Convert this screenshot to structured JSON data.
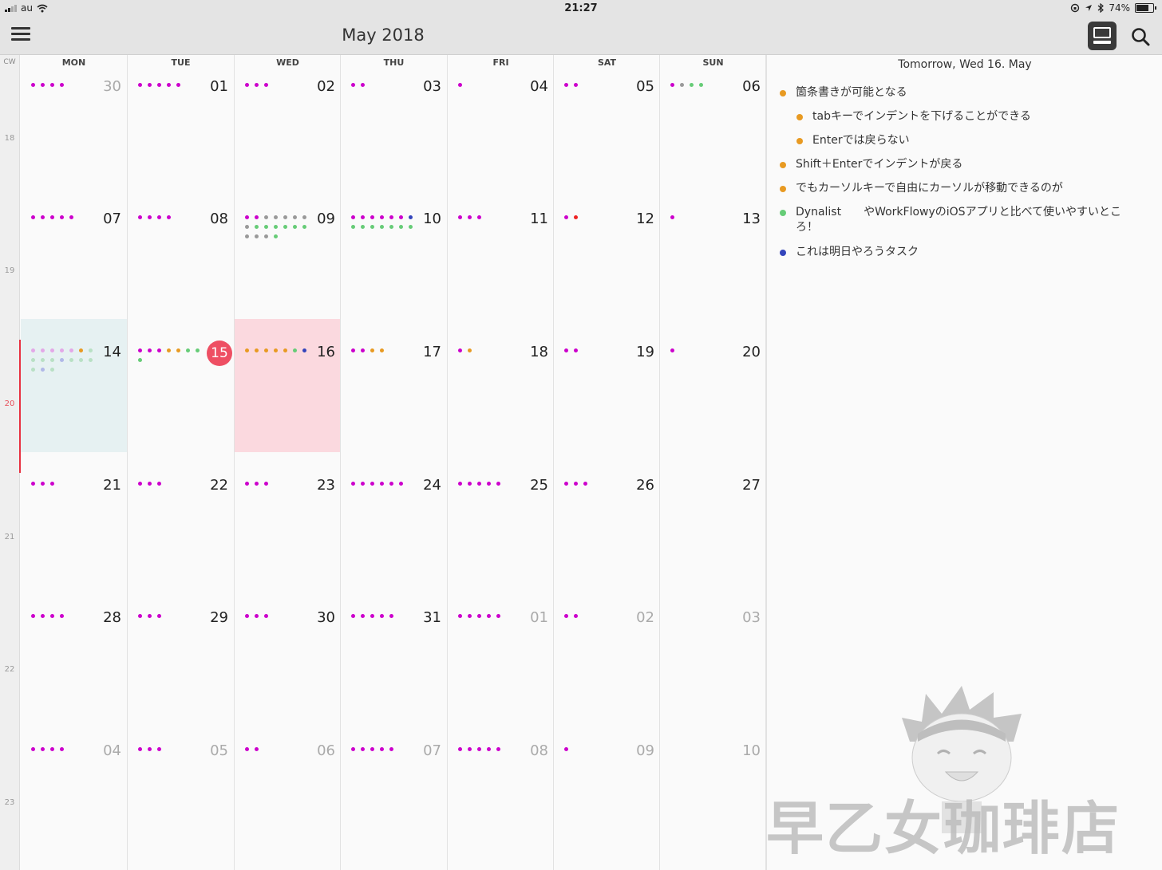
{
  "status_bar": {
    "carrier": "au",
    "time": "21:27",
    "battery": "74%",
    "battery_level": 0.74
  },
  "header": {
    "title": "May 2018",
    "menu_icon": "hamburger-icon",
    "view_icon": "tablet-layout-icon",
    "search_icon": "search-icon"
  },
  "calendar": {
    "cw_label": "CW",
    "weekdays": [
      "MON",
      "TUE",
      "WED",
      "THU",
      "FRI",
      "SAT",
      "SUN"
    ],
    "calendar_weeks": [
      "18",
      "19",
      "20",
      "21",
      "22",
      "23"
    ],
    "current_week": "20",
    "weeks": [
      [
        {
          "day": "30",
          "other": true,
          "dots": [
            "#cc00cc",
            "#cc00cc",
            "#cc00cc",
            "#cc00cc"
          ]
        },
        {
          "day": "01",
          "dots": [
            "#cc00cc",
            "#cc00cc",
            "#cc00cc",
            "#cc00cc",
            "#cc00cc"
          ]
        },
        {
          "day": "02",
          "dots": [
            "#cc00cc",
            "#cc00cc",
            "#cc00cc"
          ]
        },
        {
          "day": "03",
          "dots": [
            "#cc00cc",
            "#cc00cc"
          ]
        },
        {
          "day": "04",
          "dots": [
            "#cc00cc"
          ]
        },
        {
          "day": "05",
          "dots": [
            "#cc00cc",
            "#cc00cc"
          ]
        },
        {
          "day": "06",
          "dots": [
            "#cc00cc",
            "#999999",
            "#66cc77",
            "#66cc77"
          ]
        }
      ],
      [
        {
          "day": "07",
          "dots": [
            "#cc00cc",
            "#cc00cc",
            "#cc00cc",
            "#cc00cc",
            "#cc00cc"
          ]
        },
        {
          "day": "08",
          "dots": [
            "#cc00cc",
            "#cc00cc",
            "#cc00cc",
            "#cc00cc"
          ]
        },
        {
          "day": "09",
          "dots": [
            "#cc00cc",
            "#cc00cc",
            "#999999",
            "#999999",
            "#999999",
            "#999999",
            "#999999",
            "#999999",
            "#66cc77",
            "#66cc77",
            "#66cc77",
            "#66cc77",
            "#66cc77",
            "#66cc77",
            "#999999",
            "#999999",
            "#999999",
            "#66cc77"
          ]
        },
        {
          "day": "10",
          "dots": [
            "#cc00cc",
            "#cc00cc",
            "#cc00cc",
            "#cc00cc",
            "#cc00cc",
            "#cc00cc",
            "#3344bb",
            "#66cc77",
            "#66cc77",
            "#66cc77",
            "#66cc77",
            "#66cc77",
            "#66cc77",
            "#66cc77"
          ]
        },
        {
          "day": "11",
          "dots": [
            "#cc00cc",
            "#cc00cc",
            "#cc00cc"
          ]
        },
        {
          "day": "12",
          "dots": [
            "#cc00cc",
            "#ee2222"
          ]
        },
        {
          "day": "13",
          "dots": [
            "#cc00cc"
          ]
        }
      ],
      [
        {
          "day": "14",
          "today": true,
          "dots": [
            "#e3a8e8",
            "#e3a8e8",
            "#e3a8e8",
            "#e3a8e8",
            "#e3a8e8",
            "#e89a22",
            "#b8e0c4",
            "#b8e0c4",
            "#b8e0c4",
            "#b8e0c4",
            "#b0b8e8",
            "#b8e0c4",
            "#b8e0c4",
            "#b8e0c4",
            "#b8e0c4",
            "#b0b8e8",
            "#b8e0c4"
          ]
        },
        {
          "day": "15",
          "badge": true,
          "dots": [
            "#cc00cc",
            "#cc00cc",
            "#cc00cc",
            "#e89a22",
            "#e89a22",
            "#66cc77",
            "#66cc77",
            "#66cc77"
          ]
        },
        {
          "day": "16",
          "selected": true,
          "dots": [
            "#e89a22",
            "#e89a22",
            "#e89a22",
            "#e89a22",
            "#e89a22",
            "#66cc77",
            "#3344bb"
          ]
        },
        {
          "day": "17",
          "dots": [
            "#cc00cc",
            "#cc00cc",
            "#e89a22",
            "#e89a22"
          ]
        },
        {
          "day": "18",
          "dots": [
            "#cc00cc",
            "#e89a22"
          ]
        },
        {
          "day": "19",
          "dots": [
            "#cc00cc",
            "#cc00cc"
          ]
        },
        {
          "day": "20",
          "dots": [
            "#cc00cc"
          ]
        }
      ],
      [
        {
          "day": "21",
          "dots": [
            "#cc00cc",
            "#cc00cc",
            "#cc00cc"
          ]
        },
        {
          "day": "22",
          "dots": [
            "#cc00cc",
            "#cc00cc",
            "#cc00cc"
          ]
        },
        {
          "day": "23",
          "dots": [
            "#cc00cc",
            "#cc00cc",
            "#cc00cc"
          ]
        },
        {
          "day": "24",
          "dots": [
            "#cc00cc",
            "#cc00cc",
            "#cc00cc",
            "#cc00cc",
            "#cc00cc",
            "#cc00cc"
          ]
        },
        {
          "day": "25",
          "dots": [
            "#cc00cc",
            "#cc00cc",
            "#cc00cc",
            "#cc00cc",
            "#cc00cc"
          ]
        },
        {
          "day": "26",
          "dots": [
            "#cc00cc",
            "#cc00cc",
            "#cc00cc"
          ]
        },
        {
          "day": "27",
          "dots": []
        }
      ],
      [
        {
          "day": "28",
          "dots": [
            "#cc00cc",
            "#cc00cc",
            "#cc00cc",
            "#cc00cc"
          ]
        },
        {
          "day": "29",
          "dots": [
            "#cc00cc",
            "#cc00cc",
            "#cc00cc"
          ]
        },
        {
          "day": "30",
          "dots": [
            "#cc00cc",
            "#cc00cc",
            "#cc00cc"
          ]
        },
        {
          "day": "31",
          "dots": [
            "#cc00cc",
            "#cc00cc",
            "#cc00cc",
            "#cc00cc",
            "#cc00cc"
          ]
        },
        {
          "day": "01",
          "other": true,
          "dots": [
            "#cc00cc",
            "#cc00cc",
            "#cc00cc",
            "#cc00cc",
            "#cc00cc"
          ]
        },
        {
          "day": "02",
          "other": true,
          "dots": [
            "#cc00cc",
            "#cc00cc"
          ]
        },
        {
          "day": "03",
          "other": true,
          "dots": []
        }
      ],
      [
        {
          "day": "04",
          "other": true,
          "dots": [
            "#cc00cc",
            "#cc00cc",
            "#cc00cc",
            "#cc00cc"
          ]
        },
        {
          "day": "05",
          "other": true,
          "dots": [
            "#cc00cc",
            "#cc00cc",
            "#cc00cc"
          ]
        },
        {
          "day": "06",
          "other": true,
          "dots": [
            "#cc00cc",
            "#cc00cc"
          ]
        },
        {
          "day": "07",
          "other": true,
          "dots": [
            "#cc00cc",
            "#cc00cc",
            "#cc00cc",
            "#cc00cc",
            "#cc00cc"
          ]
        },
        {
          "day": "08",
          "other": true,
          "dots": [
            "#cc00cc",
            "#cc00cc",
            "#cc00cc",
            "#cc00cc",
            "#cc00cc"
          ]
        },
        {
          "day": "09",
          "other": true,
          "dots": [
            "#cc00cc"
          ]
        },
        {
          "day": "10",
          "other": true,
          "dots": []
        }
      ]
    ]
  },
  "panel": {
    "title": "Tomorrow, Wed 16. May",
    "tasks": [
      {
        "text": "箇条書きが可能となる",
        "color": "#e89a22",
        "indent": 0
      },
      {
        "text": "tabキーでインデントを下げることができる",
        "color": "#e89a22",
        "indent": 1
      },
      {
        "text": "Enterでは戻らない",
        "color": "#e89a22",
        "indent": 1
      },
      {
        "text": "Shift＋Enterでインデントが戻る",
        "color": "#e89a22",
        "indent": 0
      },
      {
        "text": "でもカーソルキーで自由にカーソルが移動できるのが",
        "color": "#e89a22",
        "indent": 0
      },
      {
        "text": "Dynalist　　やWorkFlowyのiOSアプリと比べて使いやすいところ！",
        "color": "#66cc77",
        "indent": 0
      },
      {
        "text": "これは明日やろうタスク",
        "color": "#3344bb",
        "indent": 0
      }
    ]
  },
  "watermark": {
    "text": "早乙女珈琲店"
  }
}
